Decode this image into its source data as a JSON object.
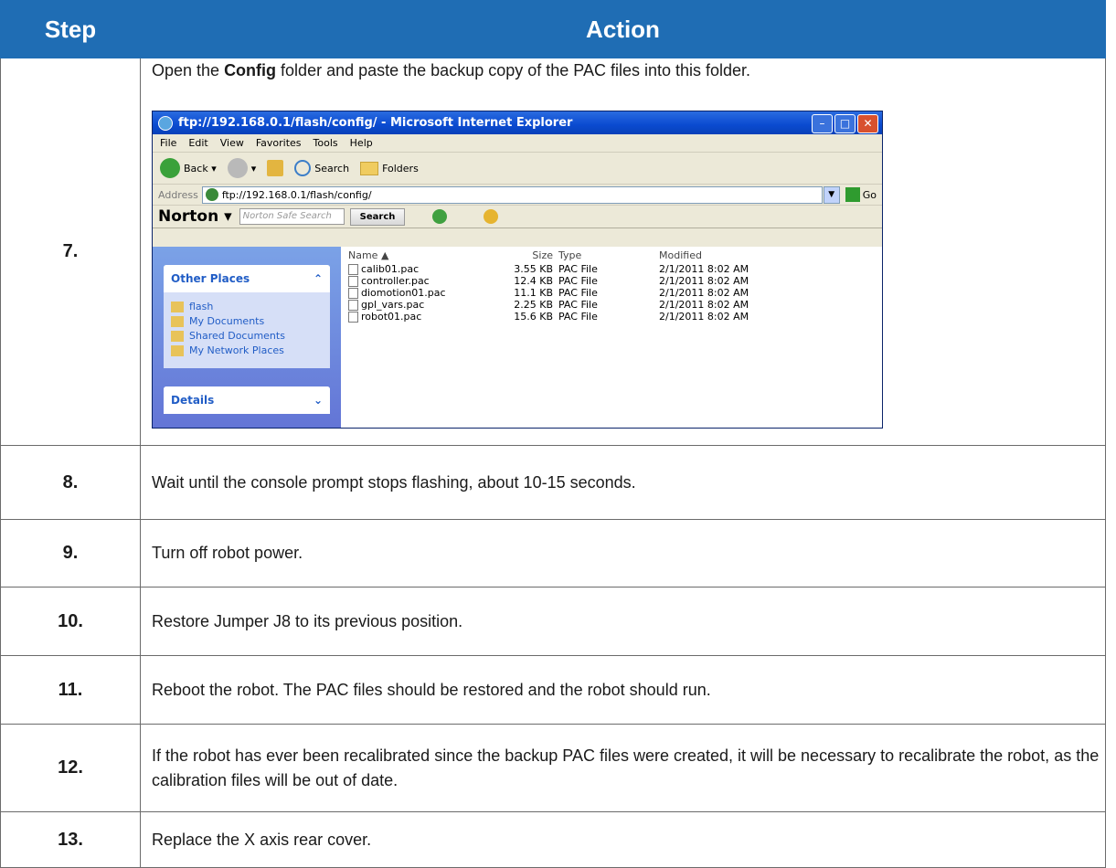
{
  "headers": {
    "step": "Step",
    "action": "Action"
  },
  "rows": [
    {
      "num": "7.",
      "pre": "Open the ",
      "bold": "Config",
      "post": " folder and paste the backup copy of the PAC files into this folder."
    },
    {
      "num": "8.",
      "text": "Wait until the console prompt stops flashing, about 10-15 seconds."
    },
    {
      "num": "9.",
      "text": "Turn off robot power."
    },
    {
      "num": "10.",
      "text": "Restore Jumper J8 to its previous position."
    },
    {
      "num": "11.",
      "text": "Reboot the robot. The PAC files should be restored and the robot should run."
    },
    {
      "num": "12.",
      "text": "If the robot has ever been recalibrated since the backup PAC files were created, it will be necessary to recalibrate the robot, as the calibration files will be out of date."
    },
    {
      "num": "13.",
      "text": "Replace the X axis rear cover."
    }
  ],
  "screenshot": {
    "title": "ftp://192.168.0.1/flash/config/ - Microsoft Internet Explorer",
    "menu": [
      "File",
      "Edit",
      "View",
      "Favorites",
      "Tools",
      "Help"
    ],
    "toolbar": {
      "back": "Back",
      "search": "Search",
      "folders": "Folders"
    },
    "address": {
      "label": "Address",
      "value": "ftp://192.168.0.1/flash/config/",
      "go": "Go"
    },
    "norton": {
      "logo": "Norton",
      "placeholder": "Norton Safe Search",
      "search_button": "Search"
    },
    "sidebar": {
      "other_places_title": "Other Places",
      "places": [
        "flash",
        "My Documents",
        "Shared Documents",
        "My Network Places"
      ],
      "details_title": "Details"
    },
    "columns": [
      "Name",
      "Size",
      "Type",
      "Modified"
    ],
    "files": [
      {
        "name": "calib01.pac",
        "size": "3.55 KB",
        "type": "PAC File",
        "modified": "2/1/2011 8:02 AM"
      },
      {
        "name": "controller.pac",
        "size": "12.4 KB",
        "type": "PAC File",
        "modified": "2/1/2011 8:02 AM"
      },
      {
        "name": "diomotion01.pac",
        "size": "11.1 KB",
        "type": "PAC File",
        "modified": "2/1/2011 8:02 AM"
      },
      {
        "name": "gpl_vars.pac",
        "size": "2.25 KB",
        "type": "PAC File",
        "modified": "2/1/2011 8:02 AM"
      },
      {
        "name": "robot01.pac",
        "size": "15.6 KB",
        "type": "PAC File",
        "modified": "2/1/2011 8:02 AM"
      }
    ]
  }
}
